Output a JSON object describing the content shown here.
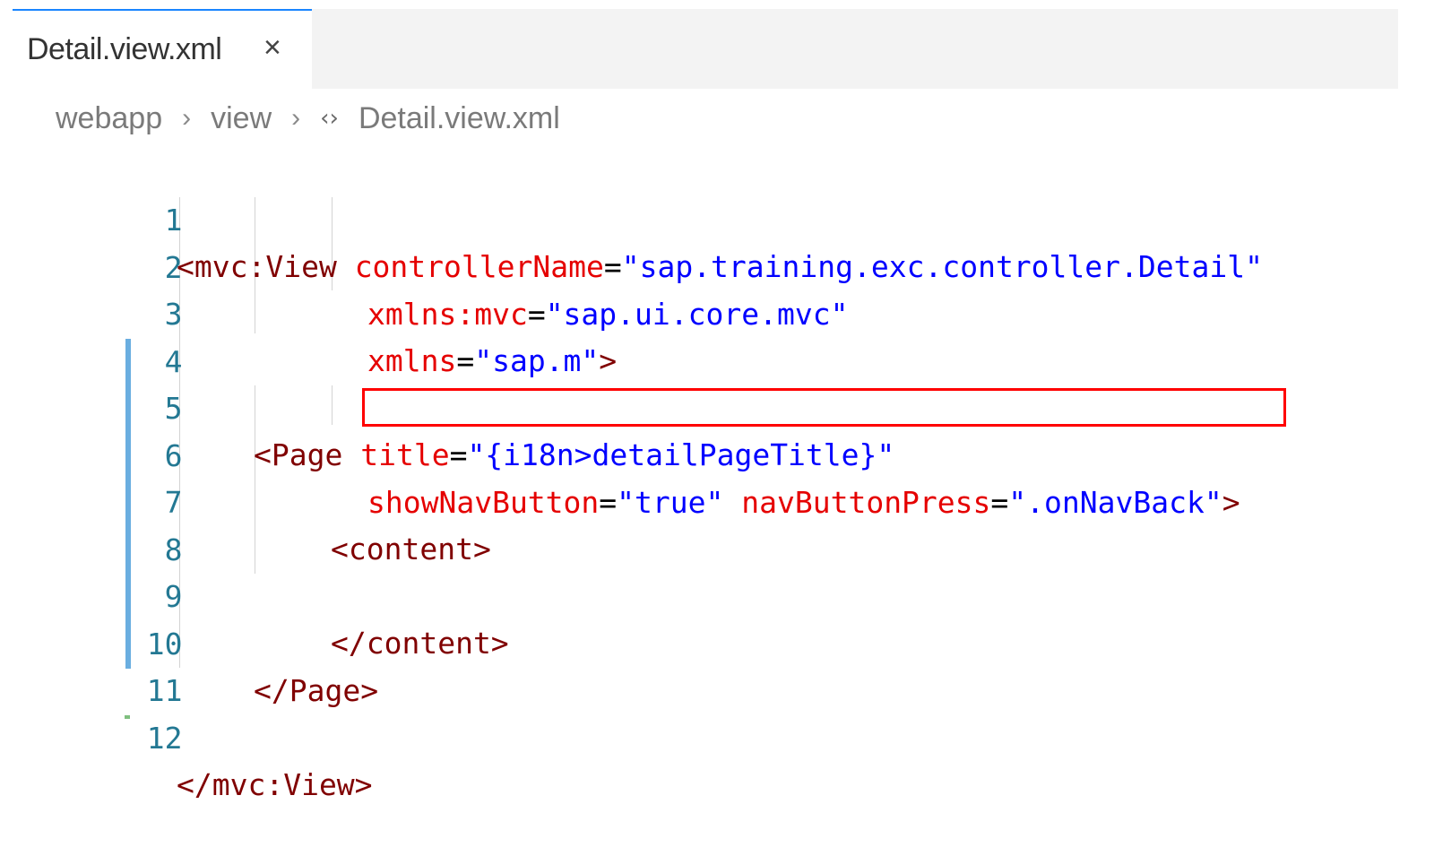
{
  "tab": {
    "label": "Detail.view.xml",
    "close_icon": "×"
  },
  "breadcrumb": {
    "items": [
      "webapp",
      "view",
      "Detail.view.xml"
    ],
    "separator": "›",
    "file_icon": "‹›"
  },
  "editor": {
    "line_numbers": [
      "1",
      "2",
      "3",
      "4",
      "5",
      "6",
      "7",
      "8",
      "9",
      "10",
      "11",
      "12"
    ],
    "lines": {
      "l1": {
        "open": "<mvc:View ",
        "attr": "controllerName",
        "eq": "=",
        "val": "\"sap.training.exc.controller.Detail\""
      },
      "l2": {
        "attr": "xmlns:mvc",
        "eq": "=",
        "val": "\"sap.ui.core.mvc\""
      },
      "l3": {
        "attr": "xmlns",
        "eq": "=",
        "val": "\"sap.m\"",
        "close": ">"
      },
      "l5": {
        "open": "<Page ",
        "attr": "title",
        "eq": "=",
        "val": "\"{i18n>detailPageTitle}\""
      },
      "l6": {
        "attr1": "showNavButton",
        "eq1": "=",
        "val1": "\"true\"",
        "attr2": "navButtonPress",
        "eq2": "=",
        "val2": "\".onNavBack\"",
        "close": ">"
      },
      "l7": {
        "tag": "<content>"
      },
      "l9": {
        "tag": "</content>"
      },
      "l10": {
        "tag": "</Page>"
      },
      "l12": {
        "tag": "</mvc:View>"
      }
    }
  },
  "colors": {
    "tag": "#800000",
    "attribute": "#e50000",
    "value": "#0000ff",
    "line_number": "#237893",
    "highlight_border": "#ff0000",
    "tab_accent": "#1a85ff"
  }
}
